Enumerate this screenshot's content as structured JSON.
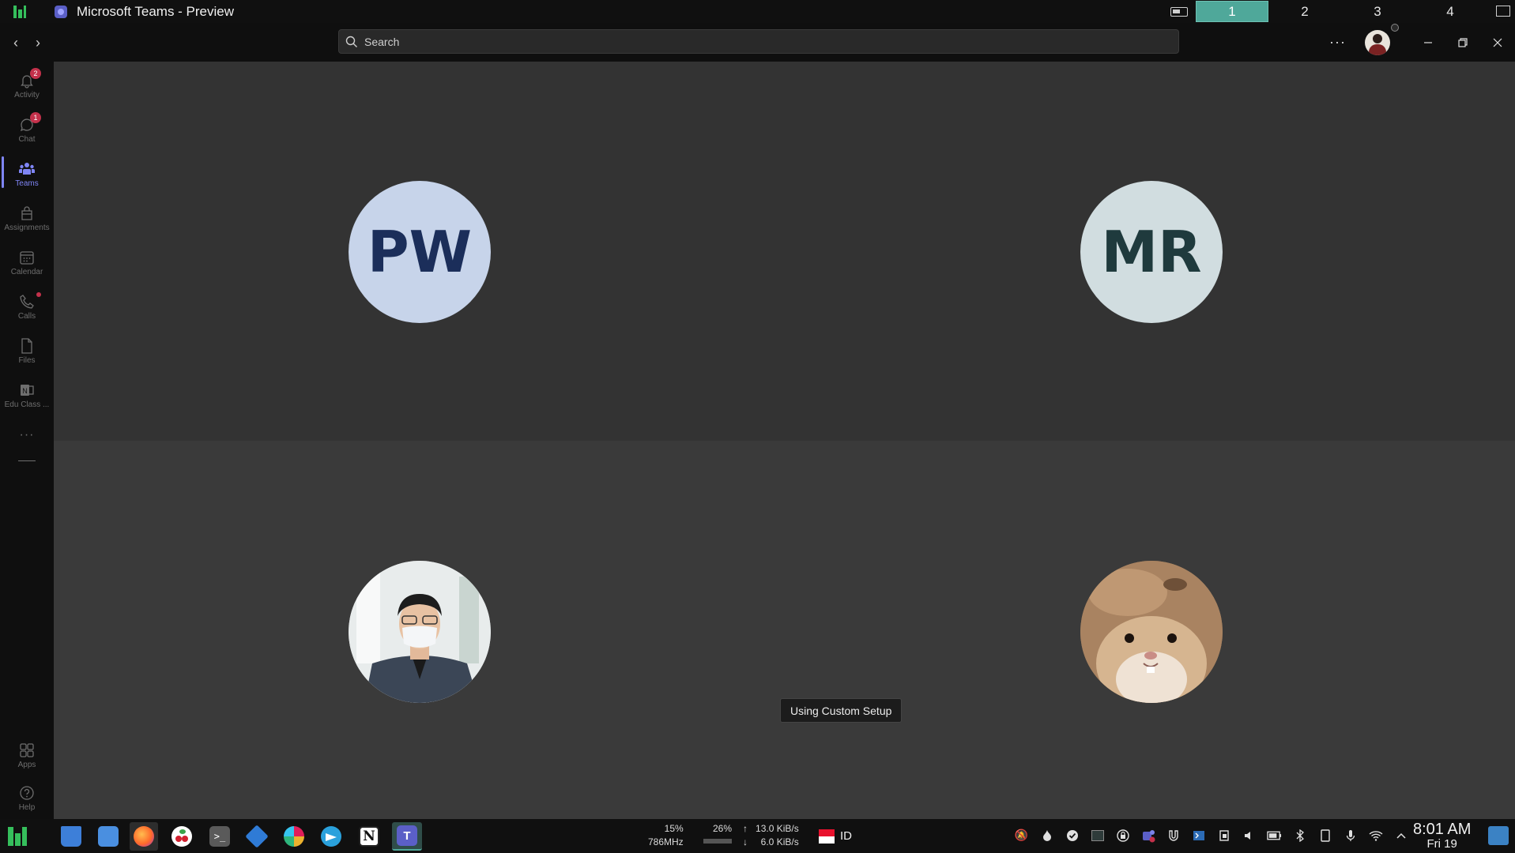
{
  "window": {
    "title": "Microsoft Teams - Preview"
  },
  "workspaces": [
    "1",
    "2",
    "3",
    "4"
  ],
  "active_workspace": "1",
  "search": {
    "placeholder": "Search"
  },
  "header": {
    "more_label": "···"
  },
  "rail": {
    "items": [
      {
        "label": "Activity",
        "icon": "bell-icon",
        "badge": "2"
      },
      {
        "label": "Chat",
        "icon": "chat-icon",
        "badge": "1"
      },
      {
        "label": "Teams",
        "icon": "teams-icon",
        "active": true
      },
      {
        "label": "Assignments",
        "icon": "assignments-icon"
      },
      {
        "label": "Calendar",
        "icon": "calendar-icon"
      },
      {
        "label": "Calls",
        "icon": "phone-icon",
        "dot": true
      },
      {
        "label": "Files",
        "icon": "file-icon"
      },
      {
        "label": "Edu Class ...",
        "icon": "onenote-icon"
      }
    ],
    "more_label": "···",
    "bottom_items": [
      {
        "label": "Apps",
        "icon": "apps-icon"
      },
      {
        "label": "Help",
        "icon": "help-icon"
      }
    ]
  },
  "participants": [
    {
      "initials": "PW",
      "bg": "#c7d4ea",
      "fg": "#1b2e5a",
      "type": "initials"
    },
    {
      "initials": "MR",
      "bg": "#d1dde0",
      "fg": "#1f3a3d",
      "type": "initials"
    },
    {
      "type": "photo",
      "subject": "man-with-mask-photo"
    },
    {
      "type": "photo",
      "subject": "hamster-photo"
    }
  ],
  "tooltip": {
    "text": "Using Custom Setup"
  },
  "taskbar": {
    "cpu_percent": "15%",
    "cpu_freq": "786MHz",
    "mem_percent": "26%",
    "upload": "13.0 KiB/s",
    "download": "6.0 KiB/s",
    "upload_arrow": "↑",
    "download_arrow": "↓",
    "language": "ID",
    "clock_time": "8:01 AM",
    "clock_date": "Fri 19",
    "apps": [
      "manjaro-menu-icon",
      "files-icon",
      "file-manager-icon",
      "firefox-icon",
      "cherry-icon",
      "terminal-icon",
      "virtualbox-icon",
      "slack-icon",
      "telegram-icon",
      "notion-icon",
      "teams-icon"
    ]
  },
  "colors": {
    "accent": "#7f85f5",
    "workspace_active": "#4fa89a",
    "badge": "#c4314b"
  }
}
